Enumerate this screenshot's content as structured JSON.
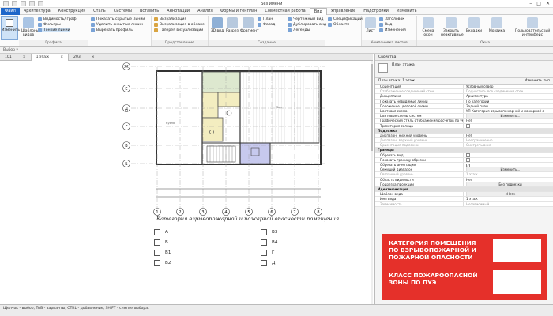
{
  "window": {
    "title": "Без имени"
  },
  "ribbon_tabs": [
    "Файл",
    "Архитектура",
    "Конструкция",
    "Сталь",
    "Системы",
    "Вставить",
    "Аннотации",
    "Анализ",
    "Формы и генплан",
    "Совместная работа",
    "Вид",
    "Управление",
    "Надстройки",
    "Изменить"
  ],
  "active_tab": "Вид",
  "ribbon": {
    "modify_label": "Изменить",
    "select_label": "Выбор",
    "panels": {
      "graphics": "Графика",
      "presentation": "Представление",
      "create": "Создание",
      "sheet": "Компоновка листов",
      "windows": "Окна"
    },
    "graphics_items": [
      "Видимость/ граф.",
      "Фильтры",
      "Тонкие линии",
      "Показать скрытые линии",
      "Удалить скрытые линии",
      "Вырезать профиль"
    ],
    "template_label": "Шаблоны видов",
    "presentation_items": [
      "Визуализация",
      "Визуализация в облаке",
      "Галерея визуализации"
    ],
    "create_items": [
      "3D вид",
      "Разрез",
      "Фрагмент",
      "План",
      "Фасад",
      "Чертежный вид",
      "Дублировать вид",
      "Легенды",
      "Спецификации",
      "Области"
    ],
    "sheet_items": [
      "Лист",
      "Заголовок",
      "Вид",
      "Изменения"
    ],
    "windows_items": [
      "Смена окон",
      "Закрыть неактивные",
      "Вкладки",
      "Мозаика",
      "Пользовательский интерфейс"
    ]
  },
  "doc_tabs": [
    {
      "label": "101",
      "active": false
    },
    {
      "label": "1 этаж",
      "active": true
    },
    {
      "label": "203",
      "active": false
    }
  ],
  "properties": {
    "header": "Свойства",
    "type_name": "План этажа",
    "selector": "План этажа: 1 этаж",
    "edit_type": "Изменить тип",
    "rows": [
      {
        "k": "Ориентация",
        "v": "Условный север",
        "kind": "normal"
      },
      {
        "k": "Отображение соединений стен",
        "v": "Подчистить все соединения стен",
        "kind": "gray"
      },
      {
        "k": "Дисциплина",
        "v": "Архитектура",
        "kind": "normal"
      },
      {
        "k": "Показать невидимые линии",
        "v": "По категории",
        "kind": "normal"
      },
      {
        "k": "Положение цветовой схемы",
        "v": "Задний план",
        "kind": "normal"
      },
      {
        "k": "Цветовая схема",
        "v": "УП Категория взрывопожарной и пожарной о",
        "kind": "normal"
      },
      {
        "k": "Цветовые схемы систем",
        "v": "Изменить...",
        "kind": "button"
      },
      {
        "k": "Графический стиль отображения расчетов по умол.",
        "v": "Нет",
        "kind": "normal"
      },
      {
        "k": "Траектория солнца",
        "v": "",
        "kind": "check"
      },
      {
        "k": "Подложка",
        "v": "",
        "kind": "section"
      },
      {
        "k": "Диапазон: нижний уровень",
        "v": "Нет",
        "kind": "normal"
      },
      {
        "k": "Диапазон: верхний уровень",
        "v": "Неограниченно",
        "kind": "gray"
      },
      {
        "k": "Ориентация подложки",
        "v": "Смотреть вниз",
        "kind": "gray"
      },
      {
        "k": "Границы",
        "v": "",
        "kind": "section"
      },
      {
        "k": "Обрезать вид",
        "v": "",
        "kind": "check"
      },
      {
        "k": "Показать границу обрезки",
        "v": "",
        "kind": "check"
      },
      {
        "k": "Обрезать аннотации",
        "v": "",
        "kind": "checked"
      },
      {
        "k": "Секущий диапазон",
        "v": "Изменить...",
        "kind": "button"
      },
      {
        "k": "Связанный уровень",
        "v": "1 этаж",
        "kind": "gray"
      },
      {
        "k": "Область видимости",
        "v": "Нет",
        "kind": "normal"
      },
      {
        "k": "Подрезка проекции",
        "v": "Без подрезки",
        "kind": "button"
      },
      {
        "k": "Идентификация",
        "v": "",
        "kind": "section"
      },
      {
        "k": "Шаблон вида",
        "v": "<Нет>",
        "kind": "button"
      },
      {
        "k": "Имя вида",
        "v": "1 этаж",
        "kind": "normal"
      },
      {
        "k": "Зависимость",
        "v": "Независимый",
        "kind": "gray"
      }
    ]
  },
  "plan": {
    "grid_rows": [
      "Б",
      "В",
      "Г",
      "Д",
      "Е",
      "Ж"
    ],
    "grid_cols": [
      "1",
      "2",
      "3",
      "4",
      "5",
      "6",
      "7",
      "8"
    ],
    "legend_title": "Категория взрывопожарной и пожарной опасности помещения",
    "legend_left": [
      "А",
      "Б",
      "В1",
      "В2"
    ],
    "legend_right": [
      "В3",
      "В4",
      "Г",
      "Д"
    ],
    "room_labels": [
      "Кухня",
      "Зал"
    ]
  },
  "banner": {
    "line1": "КАТЕГОРИЯ ПОМЕЩЕНИЯ ПО ВЗРЫВОПОЖАРНОЙ И ПОЖАРНОЙ ОПАСНОСТИ",
    "line2": "КЛАСС ПОЖАРООПАСНОЙ ЗОНЫ ПО ПУЭ",
    "color": "#e5302a"
  },
  "status": {
    "text": "Щелчок - выбор, TAB - варианты, CTRL - добавление, SHIFT - снятие выбора."
  },
  "colors": {
    "accent": "#1e66c9",
    "room_yellow": "#f3edc0",
    "room_blue": "#c7c9ee",
    "room_green": "#dde8cf"
  }
}
